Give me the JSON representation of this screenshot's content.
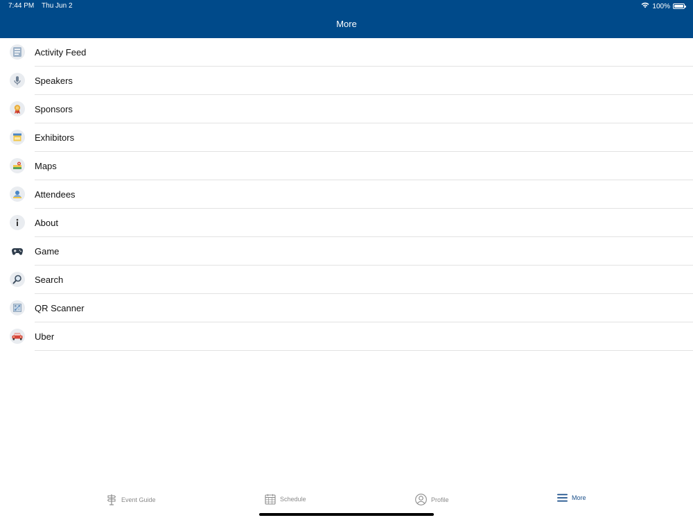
{
  "status_bar": {
    "time": "7:44 PM",
    "date": "Thu Jun 2",
    "battery": "100%",
    "wifi_icon": "wifi-icon",
    "battery_icon": "battery-icon"
  },
  "header": {
    "title": "More",
    "background_color": "#004a8a"
  },
  "menu": {
    "items": [
      {
        "label": "Activity Feed",
        "icon": "activity-feed-icon"
      },
      {
        "label": "Speakers",
        "icon": "microphone-icon"
      },
      {
        "label": "Sponsors",
        "icon": "ribbon-icon"
      },
      {
        "label": "Exhibitors",
        "icon": "booth-icon"
      },
      {
        "label": "Maps",
        "icon": "map-icon"
      },
      {
        "label": "Attendees",
        "icon": "attendees-icon"
      },
      {
        "label": "About",
        "icon": "info-icon"
      },
      {
        "label": "Game",
        "icon": "gamepad-icon"
      },
      {
        "label": "Search",
        "icon": "search-icon"
      },
      {
        "label": "QR Scanner",
        "icon": "qr-code-icon"
      },
      {
        "label": "Uber",
        "icon": "car-icon"
      }
    ]
  },
  "tab_bar": {
    "tabs": [
      {
        "label": "Event Guide",
        "icon": "signpost-icon",
        "active": false
      },
      {
        "label": "Schedule",
        "icon": "calendar-icon",
        "active": false
      },
      {
        "label": "Profile",
        "icon": "profile-icon",
        "active": false
      },
      {
        "label": "More",
        "icon": "hamburger-menu-icon",
        "active": true
      }
    ],
    "active_color": "#1a4f8a",
    "inactive_color": "#8a8a8a"
  }
}
